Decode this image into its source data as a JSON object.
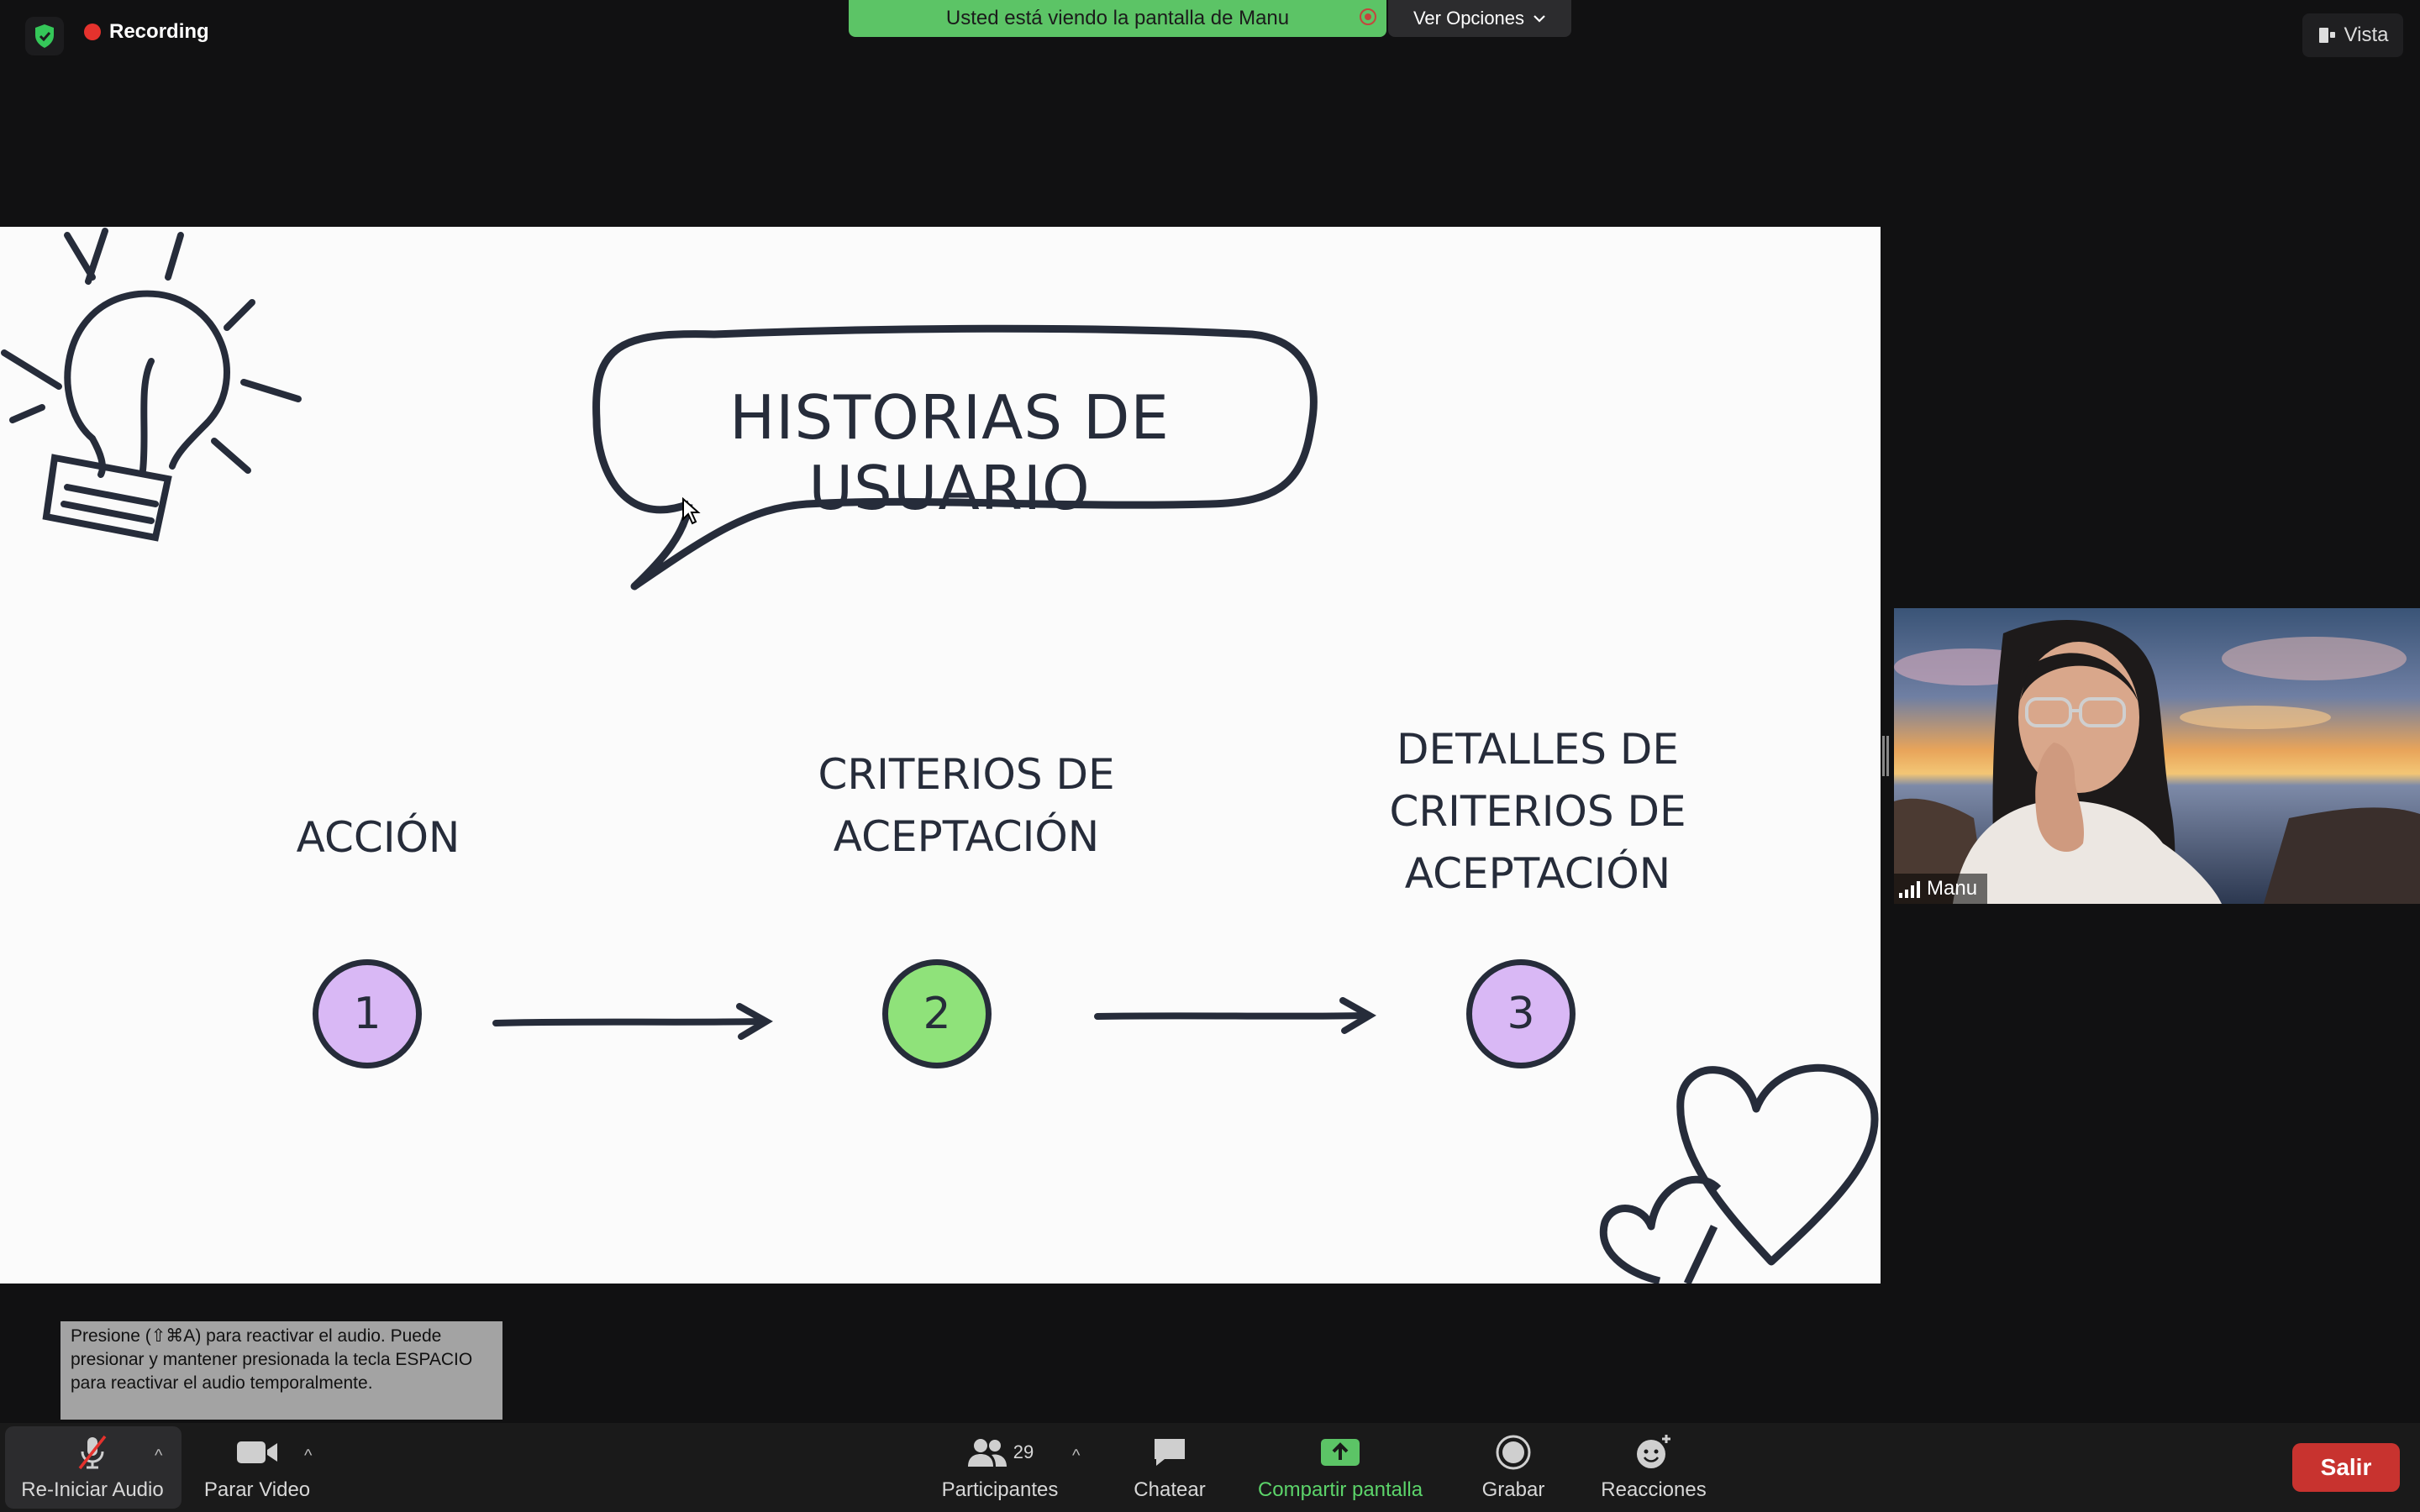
{
  "top": {
    "recording_label": "Recording",
    "share_banner": "Usted está viendo la pantalla de Manu",
    "view_options": "Ver Opciones",
    "vista": "Vista"
  },
  "slide": {
    "title": "HISTORIAS DE USUARIO",
    "steps": [
      {
        "label": "ACCIÓN",
        "number": "1",
        "color": "#d9b8f5"
      },
      {
        "label": "CRITERIOS DE\nACEPTACIÓN",
        "number": "2",
        "color": "#8fe27a"
      },
      {
        "label": "DETALLES DE\nCRITERIOS DE\nACEPTACIÓN",
        "number": "3",
        "color": "#d9b8f5"
      }
    ]
  },
  "participant": {
    "name": "Manu"
  },
  "tooltip": "Presione  (⇧⌘A) para reactivar el audio. Puede presionar y mantener presionada la tecla ESPACIO para reactivar el audio temporalmente.",
  "toolbar": {
    "audio": "Re-Iniciar Audio",
    "video": "Parar Video",
    "participants": "Participantes",
    "participants_count": "29",
    "chat": "Chatear",
    "share": "Compartir pantalla",
    "record": "Grabar",
    "reactions": "Reacciones",
    "leave": "Salir"
  },
  "colors": {
    "share_green": "#5cc466",
    "leave_red": "#c8332f",
    "slide_ink": "#262c3a"
  }
}
